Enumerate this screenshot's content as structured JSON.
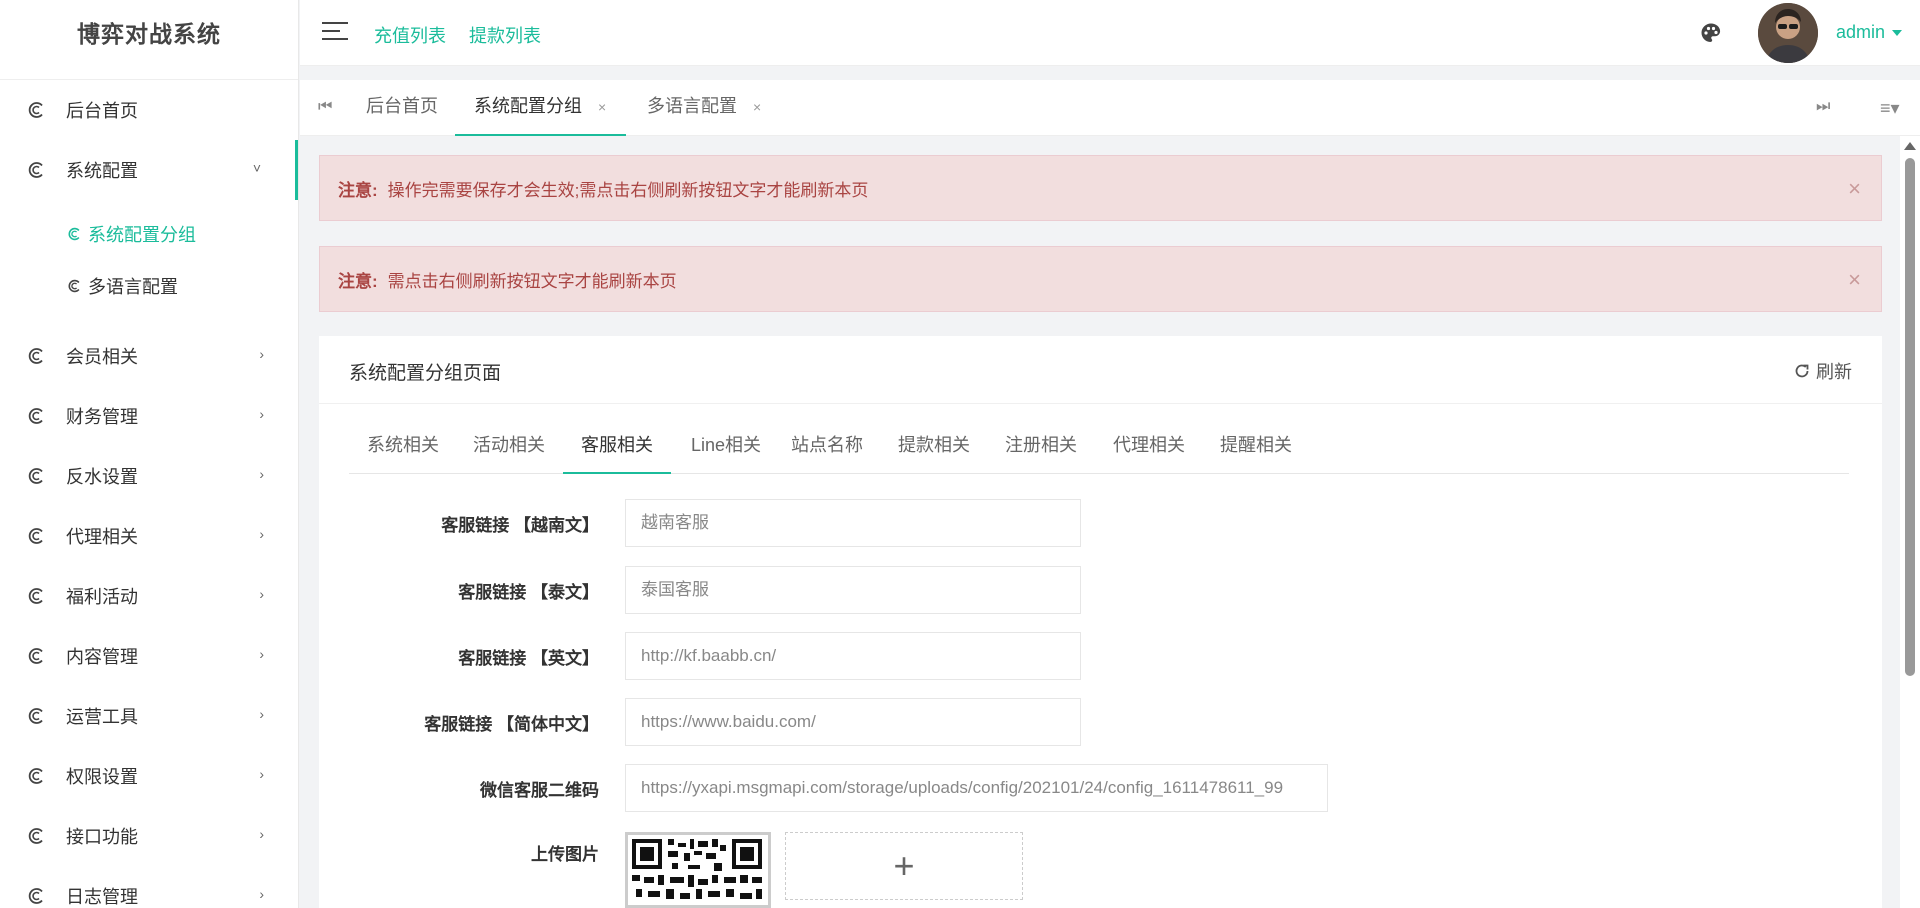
{
  "app": {
    "logo": "博弈对战系统"
  },
  "sidebar": {
    "items": [
      {
        "label": "后台首页"
      },
      {
        "label": "系统配置",
        "arrow": "˅"
      },
      {
        "label": "会员相关",
        "arrow": "›"
      },
      {
        "label": "财务管理",
        "arrow": "›"
      },
      {
        "label": "反水设置",
        "arrow": "›"
      },
      {
        "label": "代理相关",
        "arrow": "›"
      },
      {
        "label": "福利活动",
        "arrow": "›"
      },
      {
        "label": "内容管理",
        "arrow": "›"
      },
      {
        "label": "运营工具",
        "arrow": "›"
      },
      {
        "label": "权限设置",
        "arrow": "›"
      },
      {
        "label": "接口功能",
        "arrow": "›"
      },
      {
        "label": "日志管理",
        "arrow": "›"
      }
    ],
    "submenu": [
      {
        "label": "系统配置分组"
      },
      {
        "label": "多语言配置"
      }
    ]
  },
  "header": {
    "links": [
      "充值列表",
      "提款列表"
    ],
    "user": "admin"
  },
  "page_tabs": [
    {
      "label": "后台首页"
    },
    {
      "label": "系统配置分组",
      "close": "×"
    },
    {
      "label": "多语言配置",
      "close": "×"
    }
  ],
  "alerts": [
    {
      "label": "注意:",
      "text": "操作完需要保存才会生效;需点击右侧刷新按钮文字才能刷新本页",
      "close": "×"
    },
    {
      "label": "注意:",
      "text": "需点击右侧刷新按钮文字才能刷新本页",
      "close": "×"
    }
  ],
  "panel": {
    "title": "系统配置分组页面",
    "refresh_label": "刷新",
    "tabs": [
      "系统相关",
      "活动相关",
      "客服相关",
      "Line相关",
      "站点名称",
      "提款相关",
      "注册相关",
      "代理相关",
      "提醒相关"
    ],
    "active_tab": "客服相关"
  },
  "form": {
    "fields": [
      {
        "label": "客服链接 【越南文】",
        "placeholder": "越南客服"
      },
      {
        "label": "客服链接 【泰文】",
        "placeholder": "泰国客服"
      },
      {
        "label": "客服链接 【英文】",
        "placeholder": "http://kf.baabb.cn/"
      },
      {
        "label": "客服链接 【简体中文】",
        "placeholder": "https://www.baidu.com/"
      },
      {
        "label": "微信客服二维码",
        "placeholder": "https://yxapi.msgmapi.com/storage/uploads/config/202101/24/config_1611478611_99"
      }
    ],
    "upload_label": "上传图片",
    "upload_add": "+"
  },
  "icons": {
    "menu": "hamburger-icon",
    "theme": "palette-icon",
    "refresh": "refresh-icon"
  },
  "colors": {
    "accent": "#1bbc9b",
    "alert_bg": "#f2dede",
    "alert_text": "#a94442"
  }
}
